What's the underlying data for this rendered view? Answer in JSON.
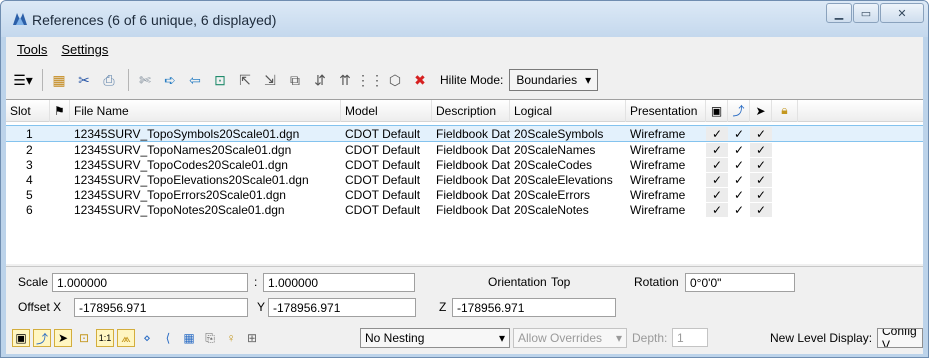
{
  "window": {
    "title": "References (6 of 6 unique, 6 displayed)"
  },
  "menu": {
    "tools": "Tools",
    "settings": "Settings"
  },
  "toolbar": {
    "hilite_label": "Hilite Mode:",
    "hilite_value": "Boundaries",
    "icons": [
      "list-view-icon",
      "attach-icon",
      "detach-icon",
      "reload-icon",
      "exchange-icon",
      "move-icon",
      "copy-icon",
      "scale-icon",
      "rotate-icon",
      "mirror-h-icon",
      "mirror-v-icon",
      "clip-boundary-icon",
      "clip-mask-icon",
      "clip-front-icon",
      "clip-back-icon",
      "models-icon",
      "delete-clip-icon"
    ]
  },
  "table": {
    "headers": {
      "slot": "Slot",
      "file": "File Name",
      "model": "Model",
      "desc": "Description",
      "logical": "Logical",
      "pres": "Presentation"
    },
    "rows": [
      {
        "slot": "1",
        "file": "12345SURV_TopoSymbols20Scale01.dgn",
        "model": "CDOT Default",
        "desc": "Fieldbook Data",
        "logical": "20ScaleSymbols",
        "pres": "Wireframe",
        "c1": "✓",
        "c2": "✓",
        "c3": "✓"
      },
      {
        "slot": "2",
        "file": "12345SURV_TopoNames20Scale01.dgn",
        "model": "CDOT Default",
        "desc": "Fieldbook Data",
        "logical": "20ScaleNames",
        "pres": "Wireframe",
        "c1": "✓",
        "c2": "✓",
        "c3": "✓"
      },
      {
        "slot": "3",
        "file": "12345SURV_TopoCodes20Scale01.dgn",
        "model": "CDOT Default",
        "desc": "Fieldbook Data",
        "logical": "20ScaleCodes",
        "pres": "Wireframe",
        "c1": "✓",
        "c2": "✓",
        "c3": "✓"
      },
      {
        "slot": "4",
        "file": "12345SURV_TopoElevations20Scale01.dgn",
        "model": "CDOT Default",
        "desc": "Fieldbook Data",
        "logical": "20ScaleElevations",
        "pres": "Wireframe",
        "c1": "✓",
        "c2": "✓",
        "c3": "✓"
      },
      {
        "slot": "5",
        "file": "12345SURV_TopoErrors20Scale01.dgn",
        "model": "CDOT Default",
        "desc": "Fieldbook Data",
        "logical": "20ScaleErrors",
        "pres": "Wireframe",
        "c1": "✓",
        "c2": "✓",
        "c3": "✓"
      },
      {
        "slot": "6",
        "file": "12345SURV_TopoNotes20Scale01.dgn",
        "model": "CDOT Default",
        "desc": "Fieldbook Data",
        "logical": "20ScaleNotes",
        "pres": "Wireframe",
        "c1": "✓",
        "c2": "✓",
        "c3": "✓"
      }
    ]
  },
  "lower": {
    "scale_label": "Scale",
    "scale1": "1.000000",
    "colon": ":",
    "scale2": "1.000000",
    "orientation_label": "Orientation",
    "orientation_value": "Top",
    "rotation_label": "Rotation",
    "rotation_value": "0°0'0\"",
    "offset_x_label": "Offset X",
    "offset_x": "-178956.971",
    "y_label": "Y",
    "offset_y": "-178956.971",
    "z_label": "Z",
    "offset_z": "-178956.971",
    "nesting": "No Nesting",
    "overrides": "Allow Overrides",
    "depth_label": "Depth:",
    "depth_value": "1",
    "new_level_label": "New Level Display:",
    "new_level_value": "Config V"
  },
  "colors": {
    "selected_row": "#e3f1fc",
    "title_text": "#1e2b3b"
  }
}
